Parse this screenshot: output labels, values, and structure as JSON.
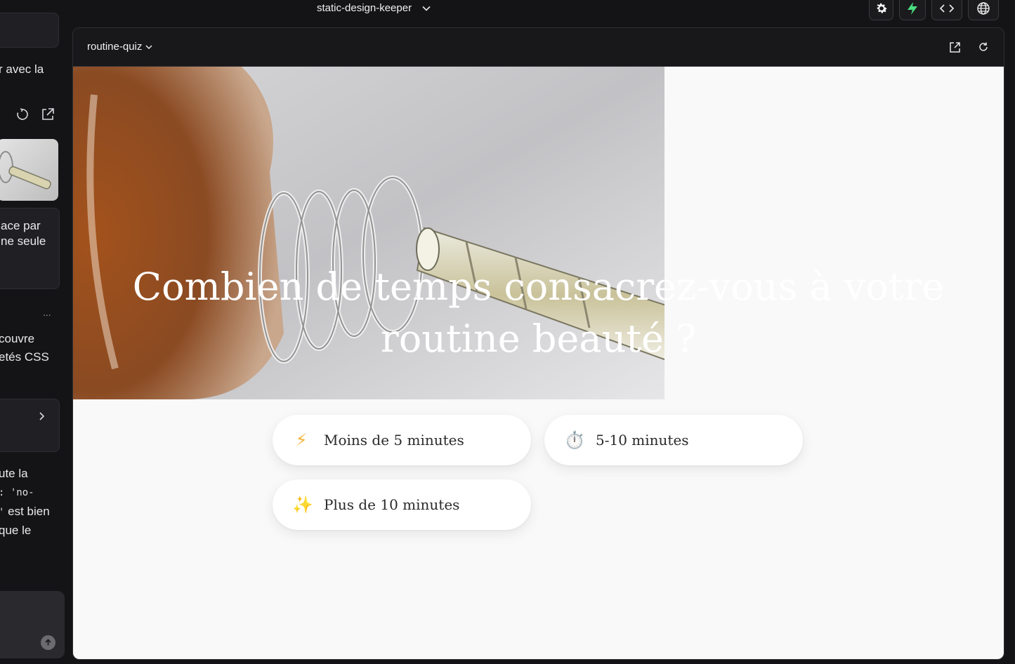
{
  "topbar": {
    "project_name": "static-design-keeper",
    "icons": [
      "gear-icon",
      "bolt-icon",
      "code-icon",
      "globe-icon"
    ]
  },
  "chat": {
    "fragment_1": "r avec la",
    "fragment_2a": "ace par",
    "fragment_2b": "ne seule",
    "more": "...",
    "fragment_3a": "couvre",
    "fragment_3b": "etés CSS",
    "fragment_4a": "ute la",
    "fragment_4b_code": ": 'no-",
    "fragment_4c_code": "'",
    "fragment_4c_text": " est bien",
    "fragment_4d": "que le"
  },
  "preview": {
    "route": "routine-quiz",
    "question": "Combien de temps consacrez-vous à votre routine beauté ?",
    "options": [
      {
        "emoji": "⚡",
        "label": "Moins de 5 minutes"
      },
      {
        "emoji": "⏱️",
        "label": "5-10 minutes"
      },
      {
        "emoji": "✨",
        "label": "Plus de 10 minutes"
      }
    ]
  },
  "colors": {
    "app_bg": "#141416",
    "preview_bg": "#f9f9f9",
    "accent_green": "#4ade80",
    "emoji_gold": "#f2b233"
  }
}
